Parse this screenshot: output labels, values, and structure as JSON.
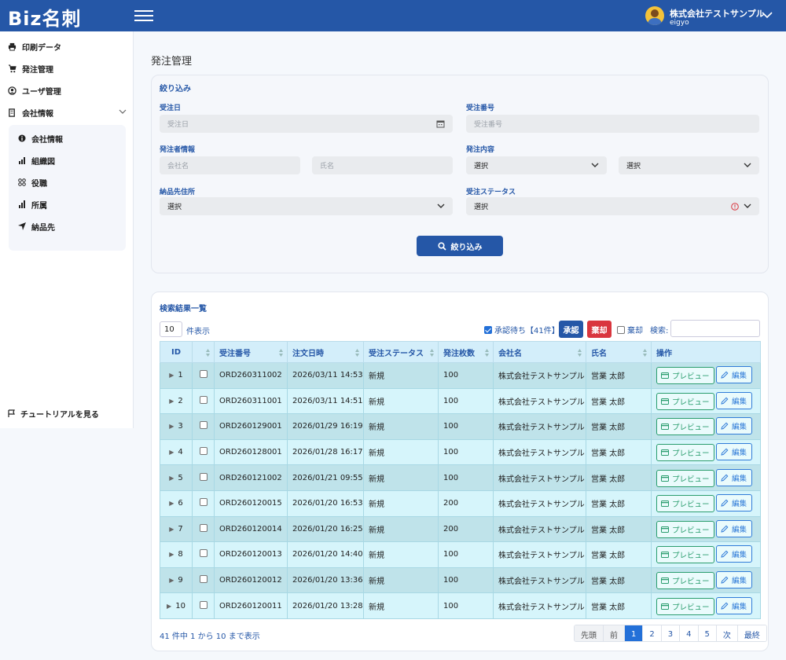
{
  "header": {
    "logo": "Biz名刺",
    "company": "株式会社テストサンプル",
    "user": "eigyo"
  },
  "sidebar": {
    "items": [
      "印刷データ",
      "発注管理",
      "ユーザ管理",
      "会社情報"
    ],
    "sub_items": [
      "会社情報",
      "組織図",
      "役職",
      "所属",
      "納品先"
    ],
    "tutorial": "チュートリアルを見る"
  },
  "page": {
    "title": "発注管理"
  },
  "filter": {
    "title": "絞り込み",
    "order_date_label": "受注日",
    "order_date_placeholder": "受注日",
    "order_no_label": "受注番号",
    "order_no_placeholder": "受注番号",
    "orderer_label": "発注者情報",
    "company_placeholder": "会社名",
    "name_placeholder": "氏名",
    "content_label": "発注内容",
    "content_select1": "選択",
    "content_select2": "選択",
    "delivery_label": "納品先住所",
    "delivery_select": "選択",
    "status_label": "受注ステータス",
    "status_select": "選択",
    "submit": "絞り込み"
  },
  "results": {
    "title": "検索結果一覧",
    "page_length": "10",
    "page_length_suffix": "件表示",
    "pending_label": "承認待ち【41件】",
    "approve": "承認",
    "reject": "棄却",
    "rejected_label": "棄却",
    "search_label": "検索:",
    "columns": [
      "ID",
      "",
      "受注番号",
      "注文日時",
      "受注ステータス",
      "発注枚数",
      "会社名",
      "氏名",
      "操作"
    ],
    "preview": "プレビュー",
    "edit": "編集",
    "rows": [
      {
        "id": "1",
        "order_no": "ORD260311002",
        "date": "2026/03/11 14:53",
        "status": "新規",
        "qty": "100",
        "company": "株式会社テストサンプル",
        "name": "営業 太郎"
      },
      {
        "id": "2",
        "order_no": "ORD260311001",
        "date": "2026/03/11 14:51",
        "status": "新規",
        "qty": "100",
        "company": "株式会社テストサンプル",
        "name": "営業 太郎"
      },
      {
        "id": "3",
        "order_no": "ORD260129001",
        "date": "2026/01/29 16:19",
        "status": "新規",
        "qty": "100",
        "company": "株式会社テストサンプル",
        "name": "営業 太郎"
      },
      {
        "id": "4",
        "order_no": "ORD260128001",
        "date": "2026/01/28 16:17",
        "status": "新規",
        "qty": "100",
        "company": "株式会社テストサンプル",
        "name": "営業 太郎"
      },
      {
        "id": "5",
        "order_no": "ORD260121002",
        "date": "2026/01/21 09:55",
        "status": "新規",
        "qty": "100",
        "company": "株式会社テストサンプル",
        "name": "営業 太郎"
      },
      {
        "id": "6",
        "order_no": "ORD260120015",
        "date": "2026/01/20 16:53",
        "status": "新規",
        "qty": "200",
        "company": "株式会社テストサンプル",
        "name": "営業 太郎"
      },
      {
        "id": "7",
        "order_no": "ORD260120014",
        "date": "2026/01/20 16:25",
        "status": "新規",
        "qty": "200",
        "company": "株式会社テストサンプル",
        "name": "営業 太郎"
      },
      {
        "id": "8",
        "order_no": "ORD260120013",
        "date": "2026/01/20 14:40",
        "status": "新規",
        "qty": "100",
        "company": "株式会社テストサンプル",
        "name": "営業 太郎"
      },
      {
        "id": "9",
        "order_no": "ORD260120012",
        "date": "2026/01/20 13:36",
        "status": "新規",
        "qty": "100",
        "company": "株式会社テストサンプル",
        "name": "営業 太郎"
      },
      {
        "id": "10",
        "order_no": "ORD260120011",
        "date": "2026/01/20 13:28",
        "status": "新規",
        "qty": "100",
        "company": "株式会社テストサンプル",
        "name": "営業 太郎"
      }
    ],
    "info": "41 件中 1 から 10 まで表示",
    "pager": [
      "先頭",
      "前",
      "1",
      "2",
      "3",
      "4",
      "5",
      "次",
      "最終"
    ],
    "current_page": "1"
  },
  "colors": {
    "primary": "#2557a7",
    "danger": "#d9363e",
    "preview": "#2a9d6e",
    "edit": "#2f7bd8"
  }
}
